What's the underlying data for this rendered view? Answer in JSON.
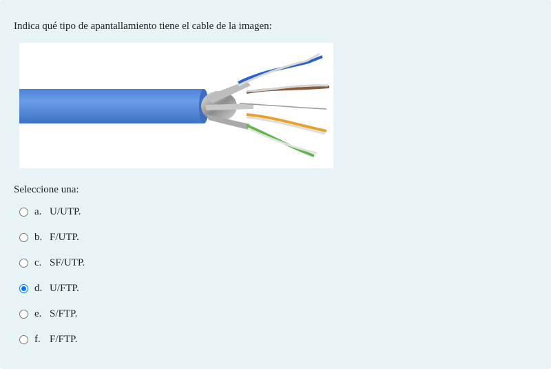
{
  "question": {
    "text": "Indica qué tipo de apantallamiento tiene el cable de la imagen:"
  },
  "image": {
    "subject": "cable-icon"
  },
  "prompt": "Seleccione una:",
  "answers": [
    {
      "letter": "a.",
      "text": "U/UTP.",
      "checked": false
    },
    {
      "letter": "b.",
      "text": "F/UTP.",
      "checked": false
    },
    {
      "letter": "c.",
      "text": "SF/UTP.",
      "checked": false
    },
    {
      "letter": "d.",
      "text": "U/FTP.",
      "checked": true
    },
    {
      "letter": "e.",
      "text": "S/FTP.",
      "checked": false
    },
    {
      "letter": "f.",
      "text": "F/FTP.",
      "checked": false
    }
  ],
  "colors": {
    "panel_background": "#e7f3f5",
    "radio_accent": "#0075ff",
    "cable_jacket": "#5a8fe0"
  }
}
